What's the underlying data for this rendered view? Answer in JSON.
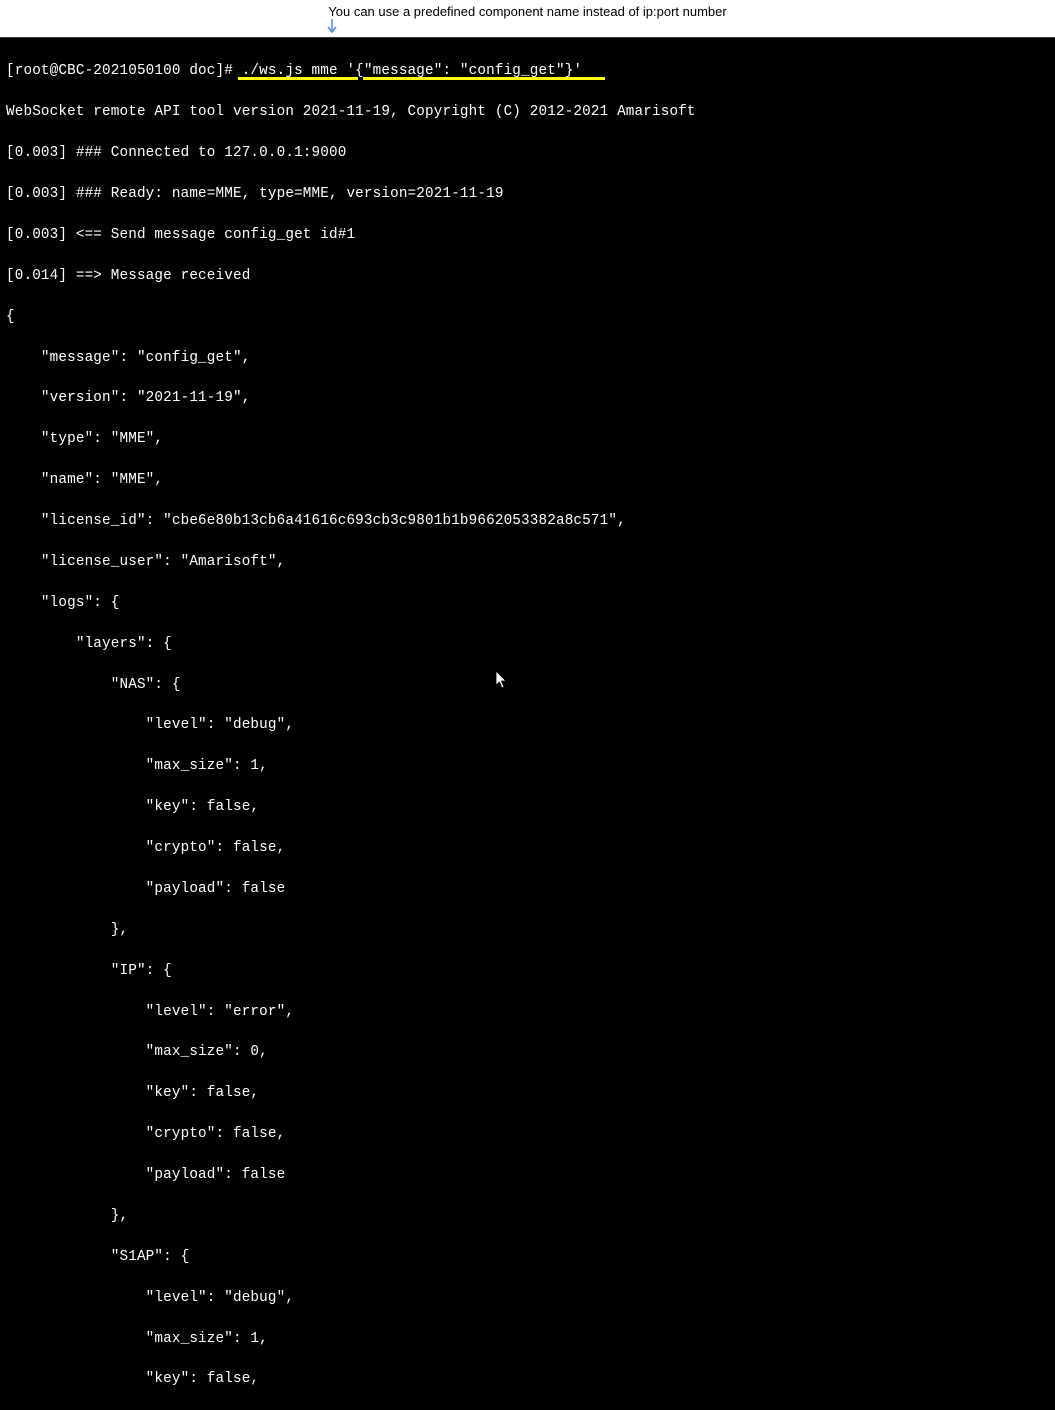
{
  "banner": {
    "text": "You can use a predefined component name instead of ip:port number"
  },
  "terminal": {
    "prompt": "[root@CBC-2021050100 doc]# ./ws.js mme '{\"message\": \"config_get\"}'",
    "lines": [
      "WebSocket remote API tool version 2021-11-19, Copyright (C) 2012-2021 Amarisoft",
      "[0.003] ### Connected to 127.0.0.1:9000",
      "[0.003] ### Ready: name=MME, type=MME, version=2021-11-19",
      "[0.003] <== Send message config_get id#1",
      "[0.014] ==> Message received",
      "{",
      "    \"message\": \"config_get\",",
      "    \"version\": \"2021-11-19\",",
      "    \"type\": \"MME\",",
      "    \"name\": \"MME\",",
      "    \"license_id\": \"cbe6e80b13cb6a41616c693cb3c9801b1b9662053382a8c571\",",
      "    \"license_user\": \"Amarisoft\",",
      "    \"logs\": {",
      "        \"layers\": {",
      "            \"NAS\": {",
      "                \"level\": \"debug\",",
      "                \"max_size\": 1,",
      "                \"key\": false,",
      "                \"crypto\": false,",
      "                \"payload\": false",
      "            },",
      "            \"IP\": {",
      "                \"level\": \"error\",",
      "                \"max_size\": 0,",
      "                \"key\": false,",
      "                \"crypto\": false,",
      "                \"payload\": false",
      "            },",
      "            \"S1AP\": {",
      "                \"level\": \"debug\",",
      "                \"max_size\": 1,",
      "                \"key\": false,"
    ]
  }
}
